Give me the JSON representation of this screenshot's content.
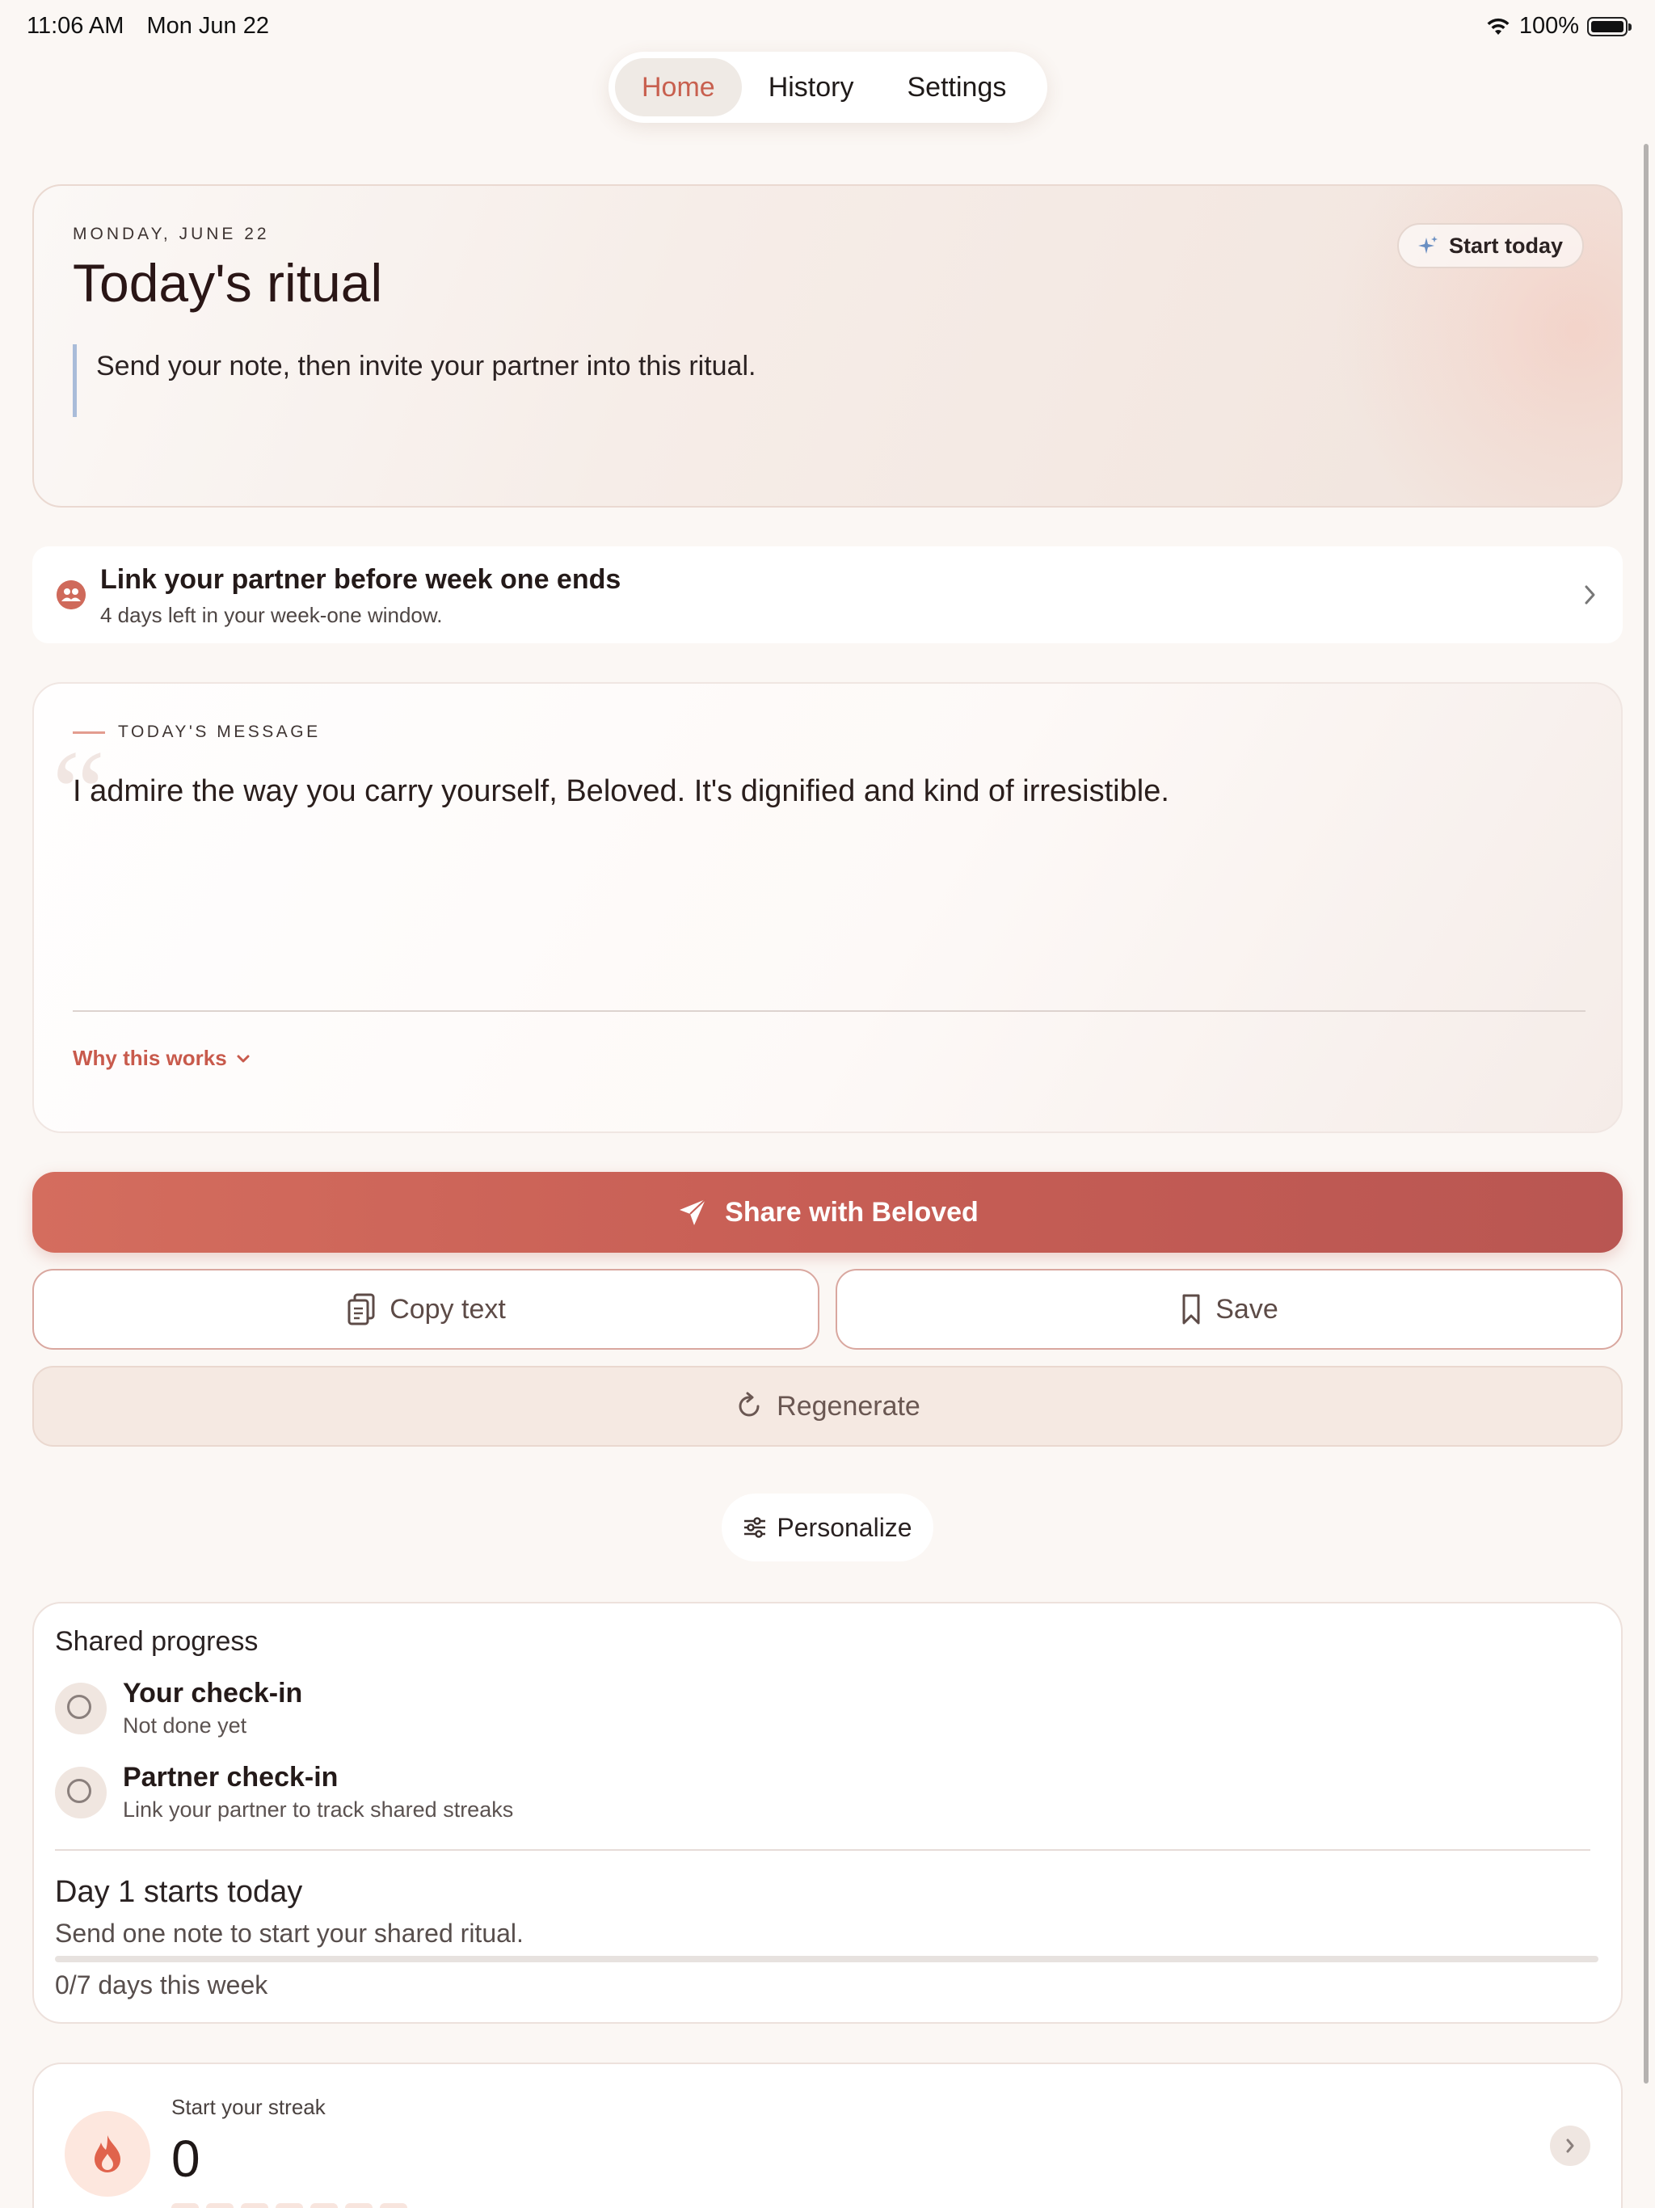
{
  "status_bar": {
    "time": "11:06 AM",
    "date": "Mon Jun 22",
    "battery_percent": "100%",
    "battery_level": 1.0
  },
  "nav": {
    "tabs": [
      {
        "label": "Home",
        "active": true
      },
      {
        "label": "History"
      },
      {
        "label": "Settings"
      }
    ]
  },
  "hero": {
    "date": "MONDAY, JUNE 22",
    "title": "Today's ritual",
    "quote": "Send your note, then invite your partner into this ritual.",
    "start_label": "Start today"
  },
  "link_partner": {
    "title": "Link your partner before week one ends",
    "subtitle": "4 days left in your week-one window."
  },
  "message": {
    "label": "TODAY'S MESSAGE",
    "quote_mark": "“",
    "text": "I admire the way you carry yourself, Beloved. It's dignified and kind of irresistible.",
    "why_label": "Why this works"
  },
  "actions": {
    "share": "Share with Beloved",
    "copy": "Copy text",
    "save": "Save",
    "regenerate": "Regenerate",
    "personalize": "Personalize"
  },
  "progress": {
    "title": "Shared progress",
    "checkins": [
      {
        "title": "Your check-in",
        "subtitle": "Not done yet"
      },
      {
        "title": "Partner check-in",
        "subtitle": "Link your partner to track shared streaks"
      }
    ],
    "day_title": "Day 1 starts today",
    "day_subtitle": "Send one note to start your shared ritual.",
    "week_progress": 0,
    "days_label": "0/7 days this week"
  },
  "streak": {
    "label": "Start your streak",
    "value": "0"
  },
  "colors": {
    "accent": "#cf6a5b",
    "background": "#fbf7f4",
    "nav_active_text": "#c8604f"
  }
}
